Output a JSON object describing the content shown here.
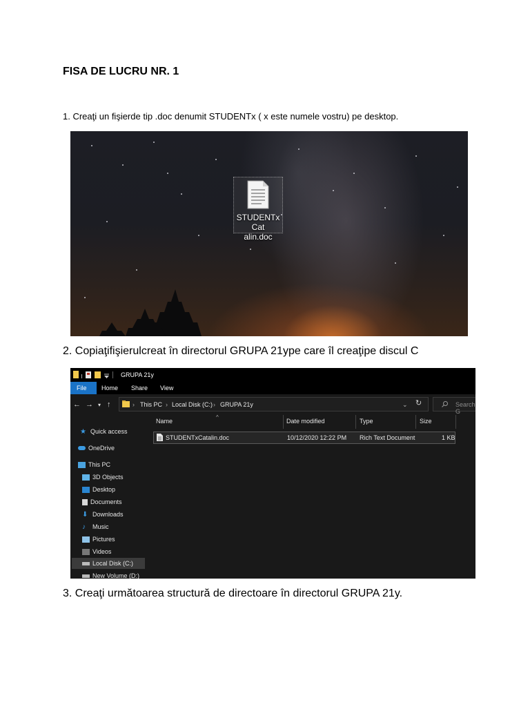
{
  "document": {
    "title": "FISA DE LUCRU NR. 1",
    "step1": "1. Creaţi un fişierde tip .doc denumit STUDENTx ( x este numele vostru) pe desktop.",
    "step2": "2. Copiaţifişierulcreat în directorul GRUPA 21ype care îl creaţipe discul C",
    "step3": "3. Creaţi următoarea structură de directoare în directorul GRUPA 21y."
  },
  "desktop": {
    "file_icon_label_line1": "STUDENTxCat",
    "file_icon_label_line2": "alin.doc"
  },
  "explorer": {
    "window_title": "GRUPA 21y",
    "ribbon_tabs": [
      "File",
      "Home",
      "Share",
      "View"
    ],
    "breadcrumb": [
      "This PC",
      "Local Disk (C:)",
      "GRUPA 21y"
    ],
    "search_placeholder": "Search G",
    "sidebar": [
      {
        "label": "Quick access",
        "icon": "star-icon"
      },
      {
        "label": "OneDrive",
        "icon": "cloud-icon"
      },
      {
        "label": "This PC",
        "icon": "computer-icon"
      },
      {
        "label": "3D Objects",
        "icon": "cube-icon"
      },
      {
        "label": "Desktop",
        "icon": "desktop-icon"
      },
      {
        "label": "Documents",
        "icon": "document-icon"
      },
      {
        "label": "Downloads",
        "icon": "download-icon"
      },
      {
        "label": "Music",
        "icon": "music-icon"
      },
      {
        "label": "Pictures",
        "icon": "pictures-icon"
      },
      {
        "label": "Videos",
        "icon": "video-icon"
      },
      {
        "label": "Local Disk (C:)",
        "icon": "drive-icon"
      },
      {
        "label": "New Volume (D:)",
        "icon": "drive-icon"
      }
    ],
    "columns": [
      "Name",
      "Date modified",
      "Type",
      "Size"
    ],
    "files": [
      {
        "name": "STUDENTxCatalin.doc",
        "date_modified": "10/12/2020 12:22 PM",
        "type": "Rich Text Document",
        "size": "1 KB"
      }
    ],
    "colors": {
      "accent": "#1a73c7",
      "background": "#191919",
      "titlebar": "#000000"
    }
  }
}
